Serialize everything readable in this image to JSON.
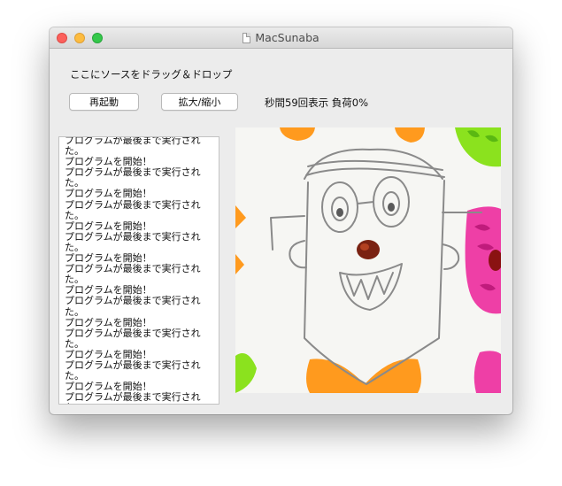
{
  "window": {
    "title": "MacSunaba"
  },
  "drop_area": {
    "label": "ここにソースをドラッグ＆ドロップ"
  },
  "toolbar": {
    "restart_label": "再起動",
    "zoom_label": "拡大/縮小",
    "stats": "秒間59回表示 負荷0%"
  },
  "log": {
    "lines": [
      "プログラムが最後まで実行された。",
      "プログラムを開始！",
      "プログラムが最後まで実行された。",
      "プログラムを開始！",
      "プログラムが最後まで実行された。",
      "プログラムを開始！",
      "プログラムが最後まで実行された。",
      "プログラムを開始！",
      "プログラムが最後まで実行された。",
      "プログラムを開始！",
      "プログラムが最後まで実行された。",
      "プログラムを開始！",
      "プログラムが最後まで実行された。",
      "プログラムを開始！",
      "プログラムが最後まで実行された。",
      "プログラムを開始！",
      "プログラムが最後まで実行された。"
    ]
  },
  "colors": {
    "close": "#fc605c",
    "minimize": "#fdbc40",
    "zoom": "#34c84a",
    "orange": "#ff9a1e",
    "green": "#8be21e",
    "magenta": "#ee3fa6",
    "pencil": "#8a8a8a"
  }
}
